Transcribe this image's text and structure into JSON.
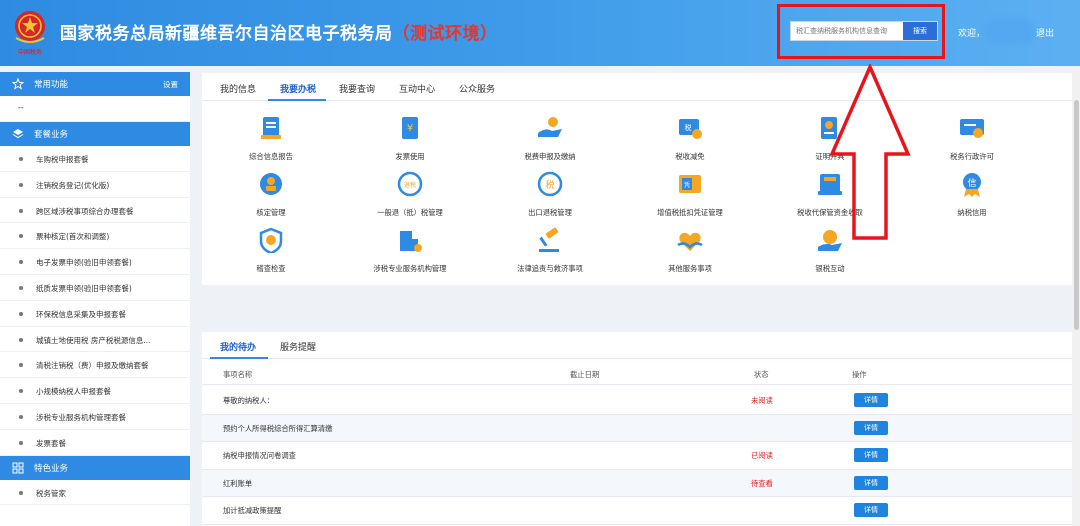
{
  "header": {
    "title": "国家税务总局新疆维吾尔自治区电子税务局",
    "env": "（测试环境）",
    "emblem_text": "中国税务",
    "search_placeholder": "税汇查纳税服务机构信息查询",
    "search_button": "搜索",
    "welcome": "欢迎，",
    "logout": "退出"
  },
  "sidebar": {
    "common_group": {
      "label": "常用功能",
      "setting": "设置"
    },
    "common_items": [
      {
        "label": "--"
      }
    ],
    "package_group": {
      "label": "套餐业务"
    },
    "package_items": [
      {
        "label": "车购税申报套餐"
      },
      {
        "label": "注销税务登记(优化版)"
      },
      {
        "label": "跨区域涉税事项综合办理套餐"
      },
      {
        "label": "票种核定(首次和调整)"
      },
      {
        "label": "电子发票申领(验旧申领套餐)"
      },
      {
        "label": "纸质发票申领(验旧申领套餐)"
      },
      {
        "label": "环保税信息采集及申报套餐"
      },
      {
        "label": "城镇土地使用税 房产税税源信息..."
      },
      {
        "label": "清税注销税（费）申报及缴纳套餐"
      },
      {
        "label": "小规模纳税人申报套餐"
      },
      {
        "label": "涉税专业服务机构管理套餐"
      },
      {
        "label": "发票套餐"
      }
    ],
    "feature_group": {
      "label": "特色业务"
    },
    "feature_items": [
      {
        "label": "税务管家"
      }
    ]
  },
  "main": {
    "tabs": [
      {
        "label": "我的信息"
      },
      {
        "label": "我要办税"
      },
      {
        "label": "我要查询"
      },
      {
        "label": "互动中心"
      },
      {
        "label": "公众服务"
      }
    ],
    "services": [
      {
        "label": "综合信息报告",
        "icon": "report-icon"
      },
      {
        "label": "发票使用",
        "icon": "invoice-icon"
      },
      {
        "label": "税费申报及缴纳",
        "icon": "tax-payment-icon"
      },
      {
        "label": "税收减免",
        "icon": "tax-reduction-icon"
      },
      {
        "label": "证明开具",
        "icon": "certificate-icon"
      },
      {
        "label": "税务行政许可",
        "icon": "license-icon"
      },
      {
        "label": "核定管理",
        "icon": "verification-icon"
      },
      {
        "label": "一般退（抵）税管理",
        "icon": "refund-icon"
      },
      {
        "label": "出口退税管理",
        "icon": "export-refund-icon"
      },
      {
        "label": "增值税抵扣凭证管理",
        "icon": "voucher-icon"
      },
      {
        "label": "税收代保管资金收取",
        "icon": "custody-icon"
      },
      {
        "label": "纳税信用",
        "icon": "credit-icon"
      },
      {
        "label": "稽查检查",
        "icon": "inspection-icon"
      },
      {
        "label": "涉税专业服务机构管理",
        "icon": "agency-icon"
      },
      {
        "label": "法律追责与救济事项",
        "icon": "legal-icon"
      },
      {
        "label": "其他服务事项",
        "icon": "other-service-icon"
      },
      {
        "label": "银税互动",
        "icon": "bank-tax-icon"
      }
    ]
  },
  "todo": {
    "tabs": [
      {
        "label": "我的待办"
      },
      {
        "label": "服务提醒"
      }
    ],
    "columns": {
      "name": "事项名称",
      "deadline": "截止日期",
      "status": "状态",
      "action": "操作"
    },
    "rows": [
      {
        "name": "尊敬的纳税人：",
        "status": "未阅读",
        "action": "详情"
      },
      {
        "name": "预约个人所得税综合所得汇算清缴",
        "status": "",
        "action": "详情"
      },
      {
        "name": "纳税申报情况问卷调查",
        "status": "已阅读",
        "action": "详情"
      },
      {
        "name": "红利账单",
        "status": "待查看",
        "action": "详情"
      },
      {
        "name": "加计抵减政策提醒",
        "status": "",
        "action": "详情"
      }
    ]
  },
  "colors": {
    "header": "#2f8be0",
    "accent": "#2e8ae3",
    "annotation": "#e8141b",
    "status_red": "#e21b1b"
  }
}
